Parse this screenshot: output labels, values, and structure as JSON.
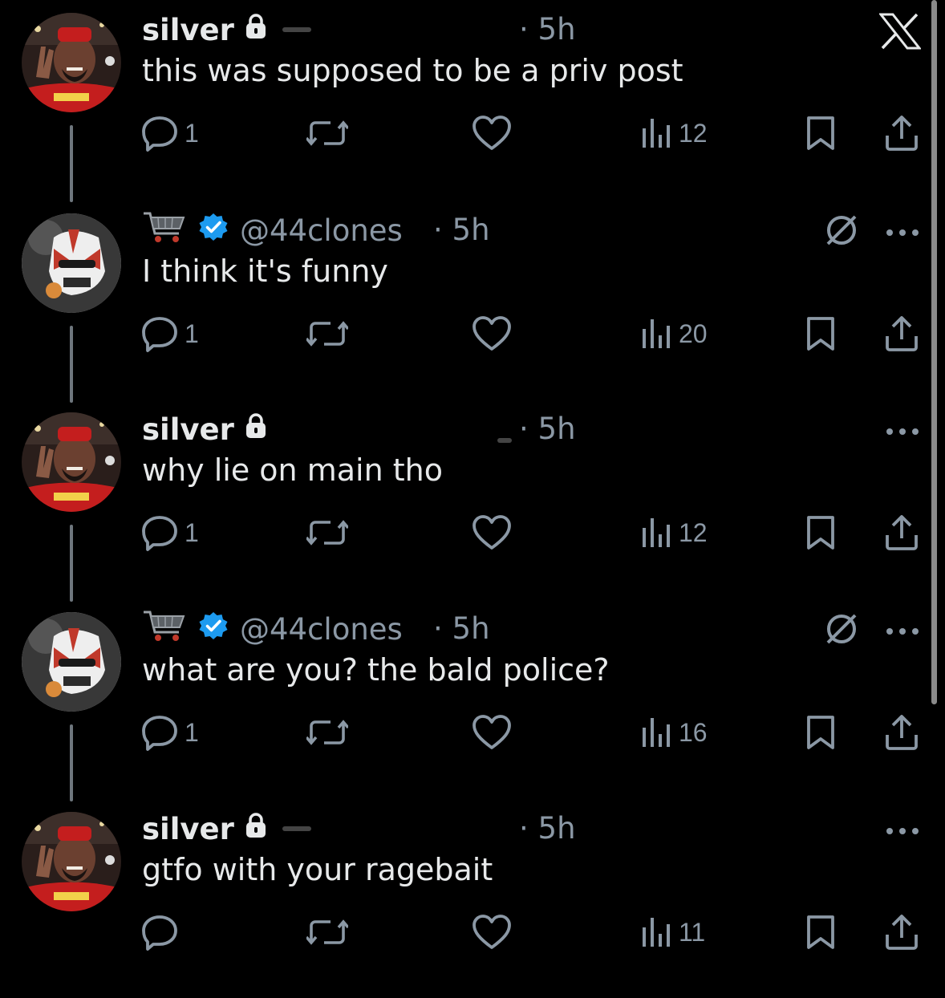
{
  "colors": {
    "background": "#000000",
    "text": "#e7e9ea",
    "muted": "#8b98a5",
    "verified": "#1d9bf0"
  },
  "app_icon": "x-logo-icon",
  "tweets": [
    {
      "author": "silver",
      "handle": "",
      "time": "· 5h",
      "text": "this was supposed to be a priv post",
      "locked": true,
      "verified": false,
      "avatar": "silver",
      "replies": "1",
      "views": "12",
      "muted": false,
      "more": false
    },
    {
      "author": "",
      "handle": "@44clones",
      "time": "· 5h",
      "text": "I think it's funny",
      "locked": false,
      "verified": true,
      "avatar": "clones",
      "replies": "1",
      "views": "20",
      "muted": true,
      "more": true
    },
    {
      "author": "silver",
      "handle": "",
      "time": "· 5h",
      "text": "why lie on main tho",
      "locked": true,
      "verified": false,
      "avatar": "silver",
      "replies": "1",
      "views": "12",
      "muted": false,
      "more": true
    },
    {
      "author": "",
      "handle": "@44clones",
      "time": "· 5h",
      "text": "what are you? the bald police?",
      "locked": false,
      "verified": true,
      "avatar": "clones",
      "replies": "1",
      "views": "16",
      "muted": true,
      "more": true
    },
    {
      "author": "silver",
      "handle": "",
      "time": "· 5h",
      "text": "gtfo with your ragebait",
      "locked": true,
      "verified": false,
      "avatar": "silver",
      "replies": "",
      "views": "11",
      "muted": false,
      "more": true
    }
  ]
}
